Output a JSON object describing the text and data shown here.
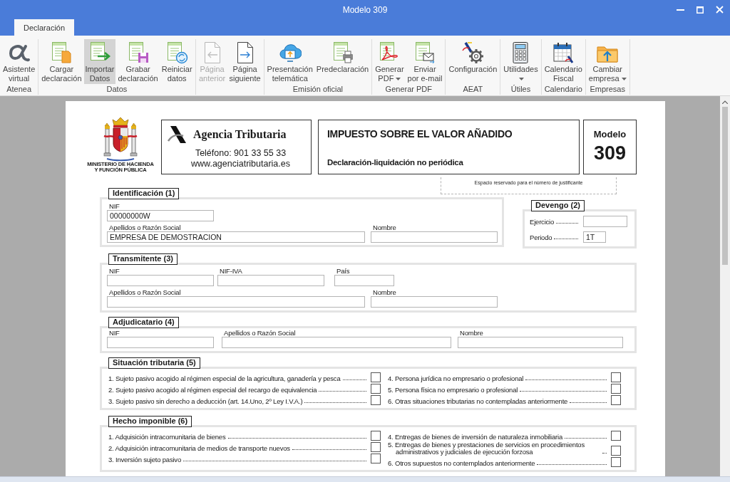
{
  "window": {
    "title": "Modelo 309"
  },
  "ribbon": {
    "tabs": [
      {
        "label": "Declaración",
        "selected": true
      }
    ],
    "groups": [
      {
        "label": "Atenea",
        "buttons": [
          {
            "label_lines": [
              "Asistente",
              "virtual"
            ],
            "highlighted": false,
            "disabled": false,
            "dropdown": false
          }
        ]
      },
      {
        "label": "Datos",
        "buttons": [
          {
            "label_lines": [
              "Cargar",
              "declaración"
            ],
            "highlighted": false,
            "disabled": false,
            "dropdown": false
          },
          {
            "label_lines": [
              "Importar",
              "Datos"
            ],
            "highlighted": true,
            "disabled": false,
            "dropdown": false
          },
          {
            "label_lines": [
              "Grabar",
              "declaración"
            ],
            "highlighted": false,
            "disabled": false,
            "dropdown": false
          },
          {
            "label_lines": [
              "Reiniciar",
              "datos"
            ],
            "highlighted": false,
            "disabled": false,
            "dropdown": false
          }
        ]
      },
      {
        "buttons": [
          {
            "label_lines": [
              "Página",
              "anterior"
            ],
            "highlighted": false,
            "disabled": true,
            "dropdown": false
          },
          {
            "label_lines": [
              "Página",
              "siguiente"
            ],
            "highlighted": false,
            "disabled": false,
            "dropdown": false
          }
        ]
      },
      {
        "label": "Emisión oficial",
        "buttons": [
          {
            "label_lines": [
              "Presentación",
              "telemática"
            ],
            "highlighted": false,
            "disabled": false,
            "dropdown": false
          },
          {
            "label_lines": [
              "Predeclaración"
            ],
            "highlighted": false,
            "disabled": false,
            "dropdown": false
          }
        ]
      },
      {
        "label": "Generar PDF",
        "buttons": [
          {
            "label_lines": [
              "Generar",
              "PDF"
            ],
            "highlighted": false,
            "disabled": false,
            "dropdown": true
          },
          {
            "label_lines": [
              "Enviar",
              "por e-mail"
            ],
            "highlighted": false,
            "disabled": false,
            "dropdown": false
          }
        ]
      },
      {
        "label": "AEAT",
        "buttons": [
          {
            "label_lines": [
              "Configuración"
            ],
            "highlighted": false,
            "disabled": false,
            "dropdown": false
          }
        ]
      },
      {
        "label": "Útiles",
        "buttons": [
          {
            "label_lines": [
              "Utilidades"
            ],
            "highlighted": false,
            "disabled": false,
            "dropdown": true
          }
        ]
      },
      {
        "label": "Calendario",
        "buttons": [
          {
            "label_lines": [
              "Calendario",
              "Fiscal"
            ],
            "highlighted": false,
            "disabled": false,
            "dropdown": false
          }
        ]
      },
      {
        "label": "Empresas",
        "buttons": [
          {
            "label_lines": [
              "Cambiar",
              "empresa"
            ],
            "highlighted": false,
            "disabled": false,
            "dropdown": true
          }
        ]
      }
    ]
  },
  "form": {
    "header": {
      "ministry_lines": [
        "MINISTERIO DE HACIENDA",
        "Y FUNCIÓN PÚBLICA"
      ],
      "agency_name": "Agencia Tributaria",
      "phone": "Teléfono: 901 33 55 33",
      "website": "www.agenciatributaria.es",
      "tax_title": "IMPUESTO SOBRE EL VALOR AÑADIDO",
      "subtitle": "Declaración-liquidación no periódica",
      "model_label": "Modelo",
      "model_number": "309"
    },
    "reserved_space": "Espacio reservado para el número de justificante",
    "identification": {
      "title": "Identificación (1)",
      "rows": [
        [
          {
            "label": "NIF",
            "value": "00000000W"
          }
        ],
        [
          {
            "label": "Apellidos o Razón Social",
            "value": "EMPRESA DE DEMOSTRACION"
          },
          {
            "label": "Nombre"
          }
        ]
      ]
    },
    "accrual": {
      "title": "Devengo (2)",
      "fields": [
        {
          "label": "Ejercicio"
        },
        {
          "label": "Periodo",
          "value": "1T"
        }
      ]
    },
    "transmitter": {
      "title": "Transmitente (3)",
      "rows": [
        [
          {
            "label": "NIF"
          },
          {
            "label": "NIF-IVA"
          },
          {
            "label": "País"
          }
        ],
        [
          {
            "label": "Apellidos o Razón Social"
          },
          {
            "label": "Nombre"
          }
        ]
      ]
    },
    "awardee": {
      "title": "Adjudicatario (4)",
      "rows": [
        [
          {
            "label": "NIF"
          },
          {
            "label": "Apellidos o Razón Social"
          },
          {
            "label": "Nombre"
          }
        ]
      ]
    },
    "tax_situation": {
      "title": "Situación tributaria (5)",
      "items": [
        {
          "text": "1. Sujeto pasivo acogido al régimen especial de la agricultura, ganadería y pesca",
          "checked": false
        },
        {
          "text": "2. Sujeto pasivo acogido al régimen especial del recargo de equivalencia",
          "checked": false
        },
        {
          "text": "3. Sujeto pasivo sin derecho a deducción (art. 14.Uno, 2º Ley I.V.A.)",
          "checked": false
        },
        {
          "text": "4. Persona jurídica no empresario o profesional",
          "checked": false
        },
        {
          "text": "5. Persona física no empresario o profesional",
          "checked": false
        },
        {
          "text": "6. Otras situaciones tributarias no contempladas anteriormente",
          "checked": false
        }
      ]
    },
    "taxable_event": {
      "title": "Hecho imponible (6)",
      "items": [
        {
          "text": "1. Adquisición intracomunitaria de bienes",
          "checked": false
        },
        {
          "text": "2. Adquisición intracomunitaria de medios de transporte nuevos",
          "checked": false
        },
        {
          "text": "3. Inversión sujeto pasivo",
          "checked": false
        },
        {
          "text": "4. Entregas de bienes de inversión de naturaleza inmobiliaria",
          "checked": false
        },
        {
          "text": "5. Entregas de bienes y prestaciones de servicios en procedimientos administrativos y judiciales de ejecución forzosa",
          "checked": false
        },
        {
          "text": "6. Otros supuestos no contemplados anteriormente",
          "checked": false
        }
      ]
    }
  }
}
